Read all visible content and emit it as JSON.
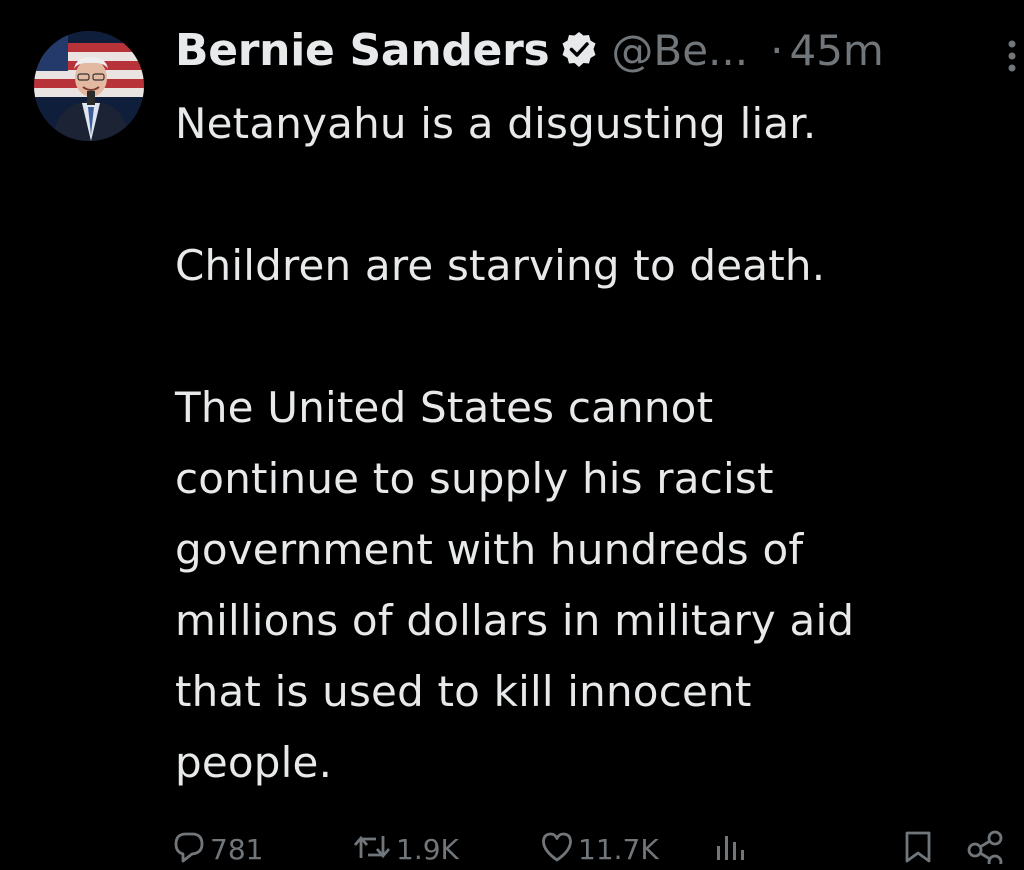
{
  "author": {
    "display_name": "Bernie Sanders",
    "handle": "@Be...",
    "separator": "·",
    "timestamp": "45m",
    "verified_icon": "verified-badge-icon",
    "avatar_icon": "avatar"
  },
  "tweet": {
    "paragraphs": [
      "Netanyahu is a disgusting liar.",
      "Children are starving to death.",
      "The United States cannot continue to supply his racist government with hundreds of millions of dollars in military aid that is used to kill innocent people."
    ],
    "line3": [
      "The United States cannot",
      "continue to supply his racist",
      "government with hundreds of",
      "millions of dollars in military aid",
      "that is used to kill innocent",
      "people."
    ]
  },
  "actions": {
    "reply_count": "781",
    "retweet_count": "1.9K",
    "like_count": "11.7K",
    "views_icon": "views-icon",
    "bookmark_icon": "bookmark-icon",
    "share_icon": "share-icon"
  },
  "colors": {
    "background": "#000000",
    "text": "#e7e9ea",
    "secondary": "#71767b",
    "verified": "#e7e9ea"
  }
}
